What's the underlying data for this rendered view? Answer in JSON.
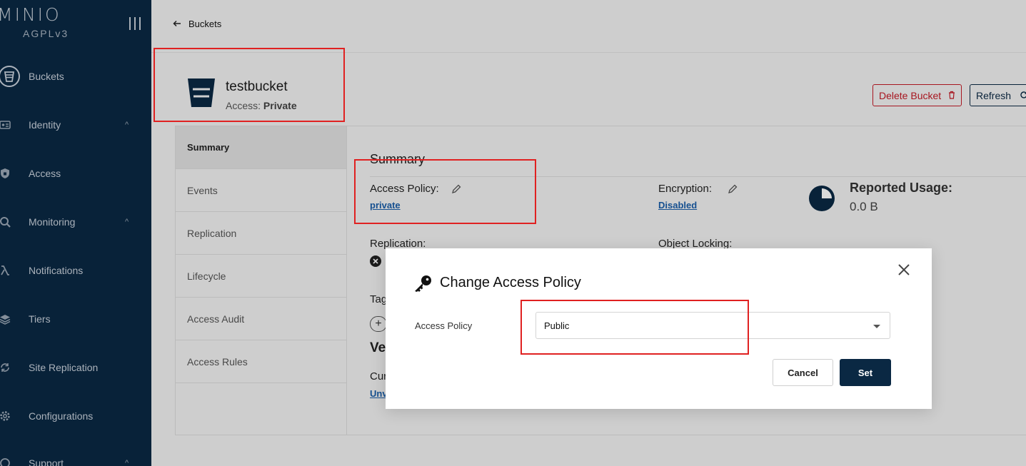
{
  "sidebar": {
    "logo": "MINIO",
    "license": "AGPLv3",
    "items": [
      {
        "label": "Buckets",
        "icon": "bucket-icon",
        "chevron": ""
      },
      {
        "label": "Identity",
        "icon": "id-card-icon",
        "chevron": "^"
      },
      {
        "label": "Access",
        "icon": "shield-icon",
        "chevron": ""
      },
      {
        "label": "Monitoring",
        "icon": "magnifier-icon",
        "chevron": "^"
      },
      {
        "label": "Notifications",
        "icon": "lambda-icon",
        "chevron": ""
      },
      {
        "label": "Tiers",
        "icon": "layers-icon",
        "chevron": ""
      },
      {
        "label": "Site Replication",
        "icon": "replication-icon",
        "chevron": ""
      },
      {
        "label": "Configurations",
        "icon": "gear-icon",
        "chevron": ""
      },
      {
        "label": "Support",
        "icon": "support-icon",
        "chevron": "^"
      }
    ]
  },
  "topbar": {
    "back_label": "Buckets"
  },
  "bucket": {
    "name": "testbucket",
    "access_prefix": "Access: ",
    "access_value": "Private",
    "delete_label": "Delete Bucket",
    "refresh_label": "Refresh"
  },
  "tabs": [
    "Summary",
    "Events",
    "Replication",
    "Lifecycle",
    "Access Audit",
    "Access Rules"
  ],
  "summary": {
    "title": "Summary",
    "access_policy_label": "Access Policy:",
    "access_policy_value": "private",
    "encryption_label": "Encryption:",
    "encryption_value": "Disabled",
    "usage_label": "Reported Usage:",
    "usage_value": "0.0 B",
    "replication_label": "Replication:",
    "object_locking_label": "Object Locking:",
    "tags_label": "Tag",
    "versioning_label": "Ve",
    "current_label": "Cur",
    "versioning_value": "Unv"
  },
  "modal": {
    "title": "Change Access Policy",
    "field_label": "Access Policy",
    "select_value": "Public",
    "cancel_label": "Cancel",
    "set_label": "Set"
  },
  "colors": {
    "sidebar_bg": "#0a2843",
    "accent": "#0a2843",
    "danger": "#c51b26",
    "annotation": "#e02121",
    "link": "#1b5faa"
  }
}
